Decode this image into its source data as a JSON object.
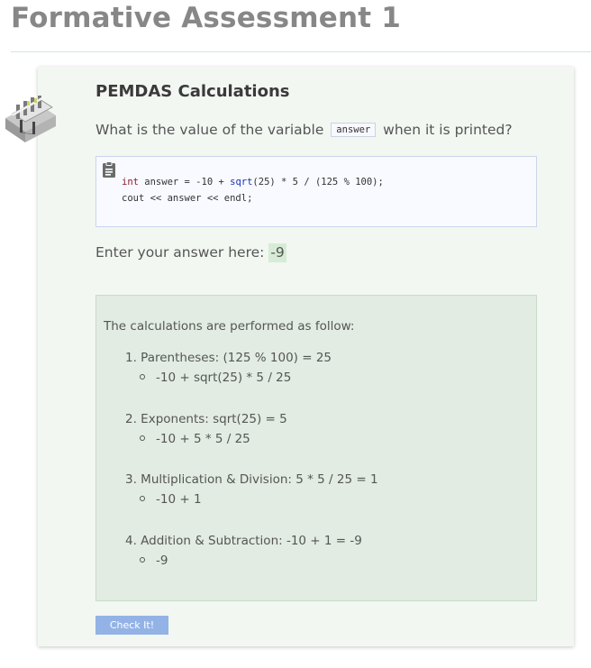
{
  "page": {
    "title": "Formative Assessment 1"
  },
  "card": {
    "heading": "PEMDAS Calculations",
    "question_before": "What is the value of the variable",
    "question_code": "answer",
    "question_after": "when it is printed?",
    "code": {
      "icon": "clipboard-icon",
      "line1_kw": "int",
      "line1_a": " answer = -10 + ",
      "line1_fn": "sqrt",
      "line1_b": "(25) * 5 / (125 % 100);",
      "line2": "cout << answer << endl;"
    },
    "answer_label": "Enter your answer here:",
    "answer_value": "-9",
    "explanation": {
      "intro": "The calculations are performed as follow:",
      "steps": [
        {
          "label": "1. Parentheses: (125 % 100) = 25",
          "detail": "-10 + sqrt(25) * 5 / 25"
        },
        {
          "label": "2. Exponents: sqrt(25) = 5",
          "detail": "-10 + 5 * 5 / 25"
        },
        {
          "label": "3. Multiplication & Division: 5 * 5 / 25 = 1",
          "detail": "-10 + 1"
        },
        {
          "label": "4. Addition & Subtraction: -10 + 1 = -9",
          "detail": "-9"
        }
      ]
    },
    "check_button": "Check It!"
  },
  "colors": {
    "card_bg": "#f2f7f2",
    "explain_bg": "#e2ece2",
    "answer_highlight": "#d6ecd6",
    "button_bg": "#93b3e6"
  }
}
